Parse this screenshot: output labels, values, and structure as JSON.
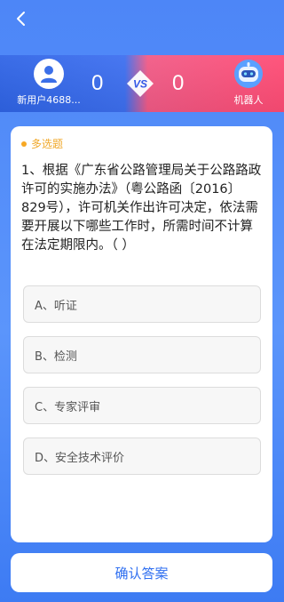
{
  "header": {
    "back_icon": "chevron-left-icon"
  },
  "battle": {
    "player": {
      "name": "新用户4688...",
      "score": "0"
    },
    "opponent": {
      "name": "机器人",
      "score": "0"
    },
    "vs_label": "VS"
  },
  "question": {
    "type": "多选题",
    "text": "1、根据《广东省公路管理局关于公路路政许可的实施办法》（粤公路函〔2016〕829号），许可机关作出许可决定，依法需要开展以下哪些工作时，所需时间不计算在法定期限内。（ ）",
    "options": [
      {
        "label": "A、听证"
      },
      {
        "label": "B、检测"
      },
      {
        "label": "C、专家评审"
      },
      {
        "label": "D、安全技术评价"
      }
    ]
  },
  "footer": {
    "confirm_label": "确认答案"
  },
  "colors": {
    "accent": "#2f6ff0",
    "type_badge": "#f0a82a",
    "opponent_band": "#ff4c75"
  }
}
